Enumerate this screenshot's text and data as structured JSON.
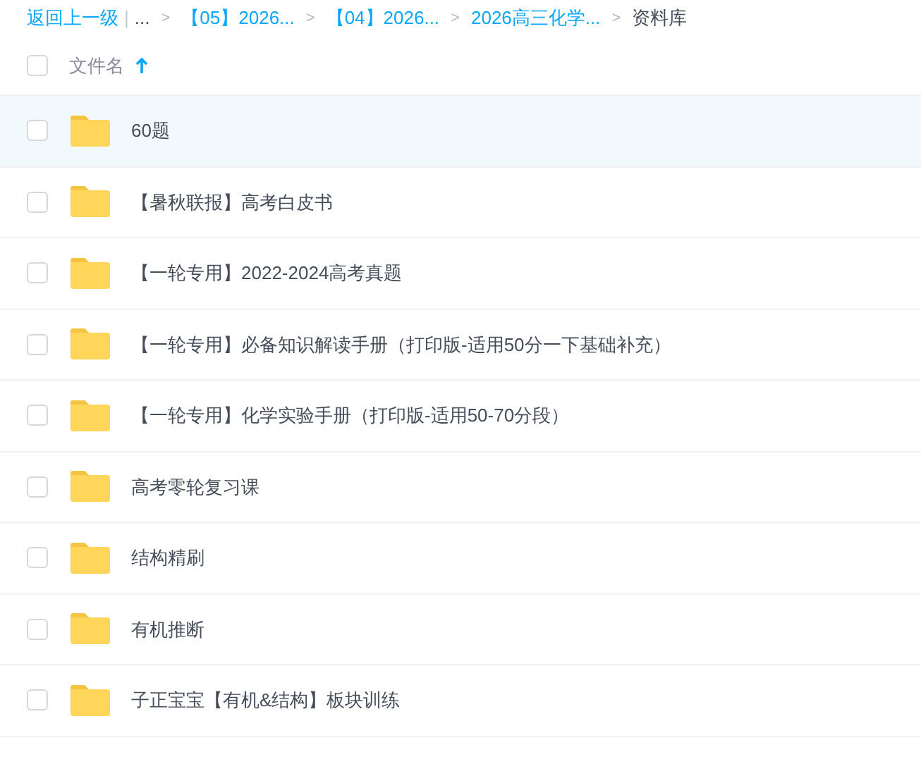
{
  "breadcrumb": [
    {
      "kind": "link",
      "text": "返回上一级"
    },
    {
      "kind": "divider",
      "text": "|"
    },
    {
      "kind": "plain",
      "text": "..."
    },
    {
      "kind": "separator",
      "text": ">"
    },
    {
      "kind": "link",
      "text": "【05】2026..."
    },
    {
      "kind": "separator",
      "text": ">"
    },
    {
      "kind": "link",
      "text": "【04】2026..."
    },
    {
      "kind": "separator",
      "text": ">"
    },
    {
      "kind": "link",
      "text": "2026高三化学..."
    },
    {
      "kind": "separator",
      "text": ">"
    },
    {
      "kind": "current",
      "text": "资料库"
    }
  ],
  "header": {
    "label": "文件名",
    "checked": false,
    "sort_ascending": true
  },
  "rows": [
    {
      "name": "60题",
      "selected": true,
      "checked": false
    },
    {
      "name": "【暑秋联报】高考白皮书",
      "selected": false,
      "checked": false
    },
    {
      "name": "【一轮专用】2022-2024高考真题",
      "selected": false,
      "checked": false
    },
    {
      "name": "【一轮专用】必备知识解读手册（打印版-适用50分一下基础补充）",
      "selected": false,
      "checked": false
    },
    {
      "name": "【一轮专用】化学实验手册（打印版-适用50-70分段）",
      "selected": false,
      "checked": false
    },
    {
      "name": "高考零轮复习课",
      "selected": false,
      "checked": false
    },
    {
      "name": "结构精刷",
      "selected": false,
      "checked": false
    },
    {
      "name": "有机推断",
      "selected": false,
      "checked": false
    },
    {
      "name": "子正宝宝【有机&结构】板块训练",
      "selected": false,
      "checked": false
    }
  ]
}
